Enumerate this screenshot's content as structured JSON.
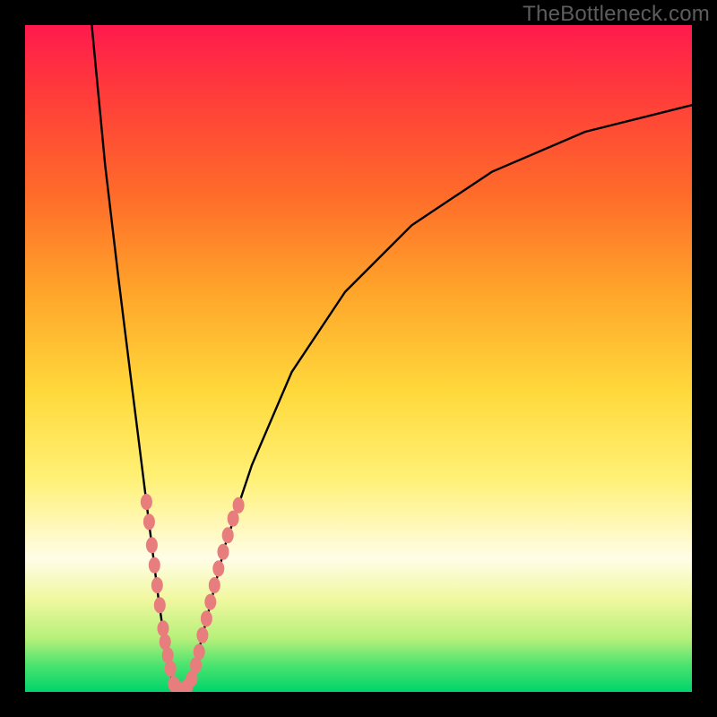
{
  "watermark": "TheBottleneck.com",
  "chart_data": {
    "type": "line",
    "title": "",
    "xlabel": "",
    "ylabel": "",
    "xlim": [
      0,
      100
    ],
    "ylim": [
      0,
      100
    ],
    "series": [
      {
        "name": "curve",
        "x": [
          10,
          12,
          14,
          16,
          17,
          18,
          19,
          20,
          21,
          22,
          23,
          24,
          25,
          26,
          28,
          30,
          34,
          40,
          48,
          58,
          70,
          84,
          100
        ],
        "values": [
          100,
          79,
          62,
          46,
          38,
          30,
          22,
          14,
          7,
          2,
          0,
          0,
          2,
          6,
          14,
          22,
          34,
          48,
          60,
          70,
          78,
          84,
          88
        ]
      }
    ],
    "markers_left": [
      {
        "x": 18.2,
        "y": 28.5
      },
      {
        "x": 18.6,
        "y": 25.5
      },
      {
        "x": 19.0,
        "y": 22.0
      },
      {
        "x": 19.4,
        "y": 19.0
      },
      {
        "x": 19.8,
        "y": 16.0
      },
      {
        "x": 20.2,
        "y": 13.0
      },
      {
        "x": 20.7,
        "y": 9.5
      },
      {
        "x": 21.0,
        "y": 7.5
      },
      {
        "x": 21.4,
        "y": 5.5
      },
      {
        "x": 21.8,
        "y": 3.5
      }
    ],
    "markers_bottom": [
      {
        "x": 22.3,
        "y": 1.2
      },
      {
        "x": 22.8,
        "y": 0.5
      },
      {
        "x": 23.5,
        "y": 0.3
      },
      {
        "x": 24.3,
        "y": 0.8
      },
      {
        "x": 25.0,
        "y": 2.0
      }
    ],
    "markers_right": [
      {
        "x": 25.6,
        "y": 4.0
      },
      {
        "x": 26.1,
        "y": 6.0
      },
      {
        "x": 26.6,
        "y": 8.5
      },
      {
        "x": 27.2,
        "y": 11.0
      },
      {
        "x": 27.8,
        "y": 13.5
      },
      {
        "x": 28.4,
        "y": 16.0
      },
      {
        "x": 29.0,
        "y": 18.5
      },
      {
        "x": 29.7,
        "y": 21.0
      },
      {
        "x": 30.4,
        "y": 23.5
      },
      {
        "x": 31.2,
        "y": 26.0
      },
      {
        "x": 32.0,
        "y": 28.0
      }
    ],
    "marker_color": "#e77d7d",
    "curve_color": "#000000"
  }
}
